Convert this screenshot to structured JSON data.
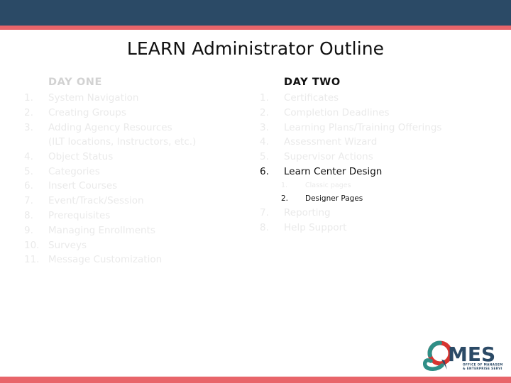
{
  "theme": {
    "header_bar_color": "#2b4a66",
    "accent_stripe_color": "#e8656a",
    "faded_text_color": "#eaeaea",
    "solid_text_color": "#111111",
    "background_color": "#ffffff"
  },
  "slide": {
    "title": "LEARN Administrator Outline"
  },
  "columns": {
    "left": {
      "heading": "DAY ONE",
      "heading_state": "faded",
      "items": [
        {
          "num": "1.",
          "label": "System Navigation",
          "state": "faded"
        },
        {
          "num": "2.",
          "label": "Creating Groups",
          "state": "faded"
        },
        {
          "num": "3.",
          "label": "Adding Agency Resources",
          "state": "faded",
          "continuation": "(ILT locations, Instructors, etc.)"
        },
        {
          "num": "4.",
          "label": "Object Status",
          "state": "faded"
        },
        {
          "num": "5.",
          "label": "Categories",
          "state": "faded"
        },
        {
          "num": "6.",
          "label": "Insert Courses",
          "state": "faded"
        },
        {
          "num": "7.",
          "label": "Event/Track/Session",
          "state": "faded"
        },
        {
          "num": "8.",
          "label": "Prerequisites",
          "state": "faded"
        },
        {
          "num": "9.",
          "label": "Managing Enrollments",
          "state": "faded"
        },
        {
          "num": "10.",
          "label": "Surveys",
          "state": "faded"
        },
        {
          "num": "11.",
          "label": "Message Customization",
          "state": "faded"
        }
      ]
    },
    "right": {
      "heading": "DAY TWO",
      "heading_state": "solid",
      "items": [
        {
          "num": "1.",
          "label": "Certificates",
          "state": "faded"
        },
        {
          "num": "2.",
          "label": "Completion Deadlines",
          "state": "faded"
        },
        {
          "num": "3.",
          "label": "Learning Plans/Training Offerings",
          "state": "faded"
        },
        {
          "num": "4.",
          "label": "Assessment Wizard",
          "state": "faded"
        },
        {
          "num": "5.",
          "label": "Supervisor Actions",
          "state": "faded"
        },
        {
          "num": "6.",
          "label": "Learn Center Design",
          "state": "solid",
          "sub": [
            {
              "num": "1.",
              "label": "Classic pages",
              "state": "faded"
            },
            {
              "num": "2.",
              "label": "Designer Pages",
              "state": "solid"
            }
          ]
        },
        {
          "num": "7.",
          "label": "Reporting",
          "state": "faded"
        },
        {
          "num": "8.",
          "label": "Help Support",
          "state": "faded"
        }
      ]
    }
  },
  "logo": {
    "wordmark": "MES",
    "tagline_line1": "OFFICE OF MANAGEMENT",
    "tagline_line2": "& ENTERPRISE SERVICES",
    "colors": {
      "navy": "#2b4a66",
      "red": "#d7342f",
      "teal": "#2f8f87"
    }
  }
}
